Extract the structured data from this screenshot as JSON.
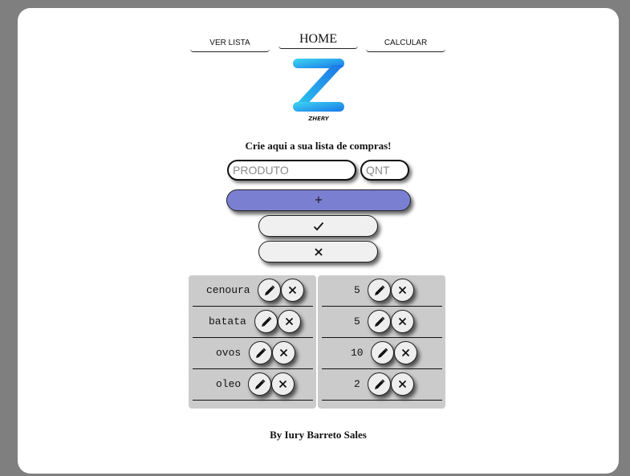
{
  "nav": {
    "items": [
      {
        "label": "VER LISTA"
      },
      {
        "label": "HOME"
      },
      {
        "label": "CALCULAR"
      }
    ]
  },
  "logo": {
    "text": "ZHERY"
  },
  "heading": "Crie aqui a sua lista de compras!",
  "form": {
    "product_placeholder": "PRODUTO",
    "qty_placeholder": "QNT",
    "add_label": "+",
    "confirm_icon": "check-icon",
    "cancel_icon": "close-icon"
  },
  "list": {
    "products": [
      "cenoura",
      "batata",
      "ovos",
      "oleo"
    ],
    "quantities": [
      "5",
      "5",
      "10",
      "2"
    ]
  },
  "footer": "By Iury Barreto Sales",
  "colors": {
    "background": "#7f7f7f",
    "card": "#ffffff",
    "add_button": "#7b7fd2",
    "list_panel": "#cbcbcb"
  }
}
